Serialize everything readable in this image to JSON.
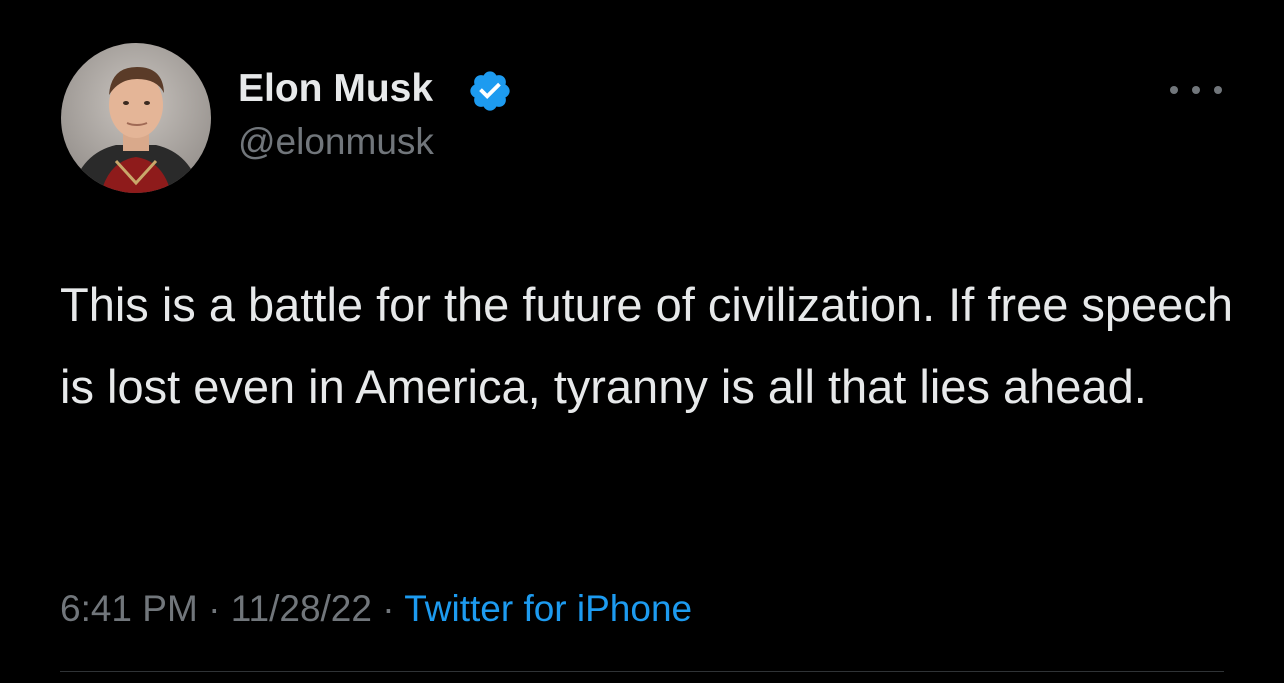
{
  "author": {
    "name": "Elon Musk",
    "handle": "@elonmusk",
    "verified": true,
    "avatar_icon": "profile-photo"
  },
  "menu": {
    "icon": "more-horizontal-icon"
  },
  "tweet": {
    "text": "This is a battle for the future of civilization. If free speech is lost even in America, tyranny is all that lies ahead.",
    "time": "6:41 PM",
    "separator": "·",
    "date": "11/28/22",
    "source": "Twitter for iPhone"
  },
  "colors": {
    "background": "#000000",
    "primary_text": "#e7e9ea",
    "secondary_text": "#71767b",
    "accent": "#1d9bf0",
    "divider": "#2f3336"
  }
}
